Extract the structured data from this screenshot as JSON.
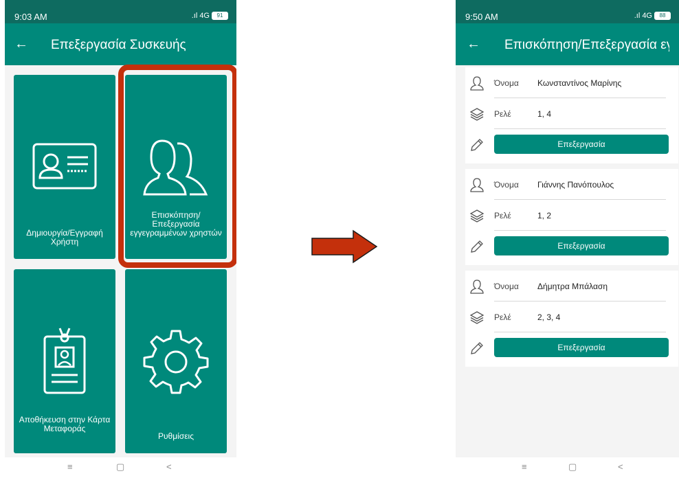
{
  "left_screen": {
    "status": {
      "time": "9:03 AM",
      "network": "4G",
      "battery": "91"
    },
    "appbar": {
      "title": "Επεξεργασία Συσκευής"
    },
    "tiles": [
      {
        "label": "Δημιουργία/Εγγραφή Χρήστη",
        "icon": "id-card-icon"
      },
      {
        "label": "Επισκόπηση/ Επεξεργασία εγγεγραμμένων χρηστών",
        "icon": "users-icon"
      },
      {
        "label": "Αποθήκευση στην Κάρτα Μεταφοράς",
        "icon": "badge-icon"
      },
      {
        "label": "Ρυθμίσεις",
        "icon": "gear-icon"
      }
    ],
    "highlight_color": "#c4300c"
  },
  "transition_arrow": {
    "color": "#c4300c"
  },
  "right_screen": {
    "status": {
      "time": "9:50 AM",
      "network": "4G",
      "battery": "88"
    },
    "appbar": {
      "title": "Επισκόπηση/Επεξεργασία εγ..."
    },
    "name_label": "Όνομα",
    "relay_label": "Ρελέ",
    "edit_label": "Επεξεργασία",
    "users": [
      {
        "name": "Κωνσταντίνος Μαρίνης",
        "relays": "1, 4"
      },
      {
        "name": "Γιάννης Πανόπουλος",
        "relays": "1, 2"
      },
      {
        "name": "Δήμητρα Μπάλαση",
        "relays": "2, 3, 4"
      }
    ]
  },
  "navbar": {
    "menu": "≡",
    "home": "▢",
    "back": "<"
  },
  "colors": {
    "primary": "#00897b",
    "status_bar": "#0e6b60"
  }
}
